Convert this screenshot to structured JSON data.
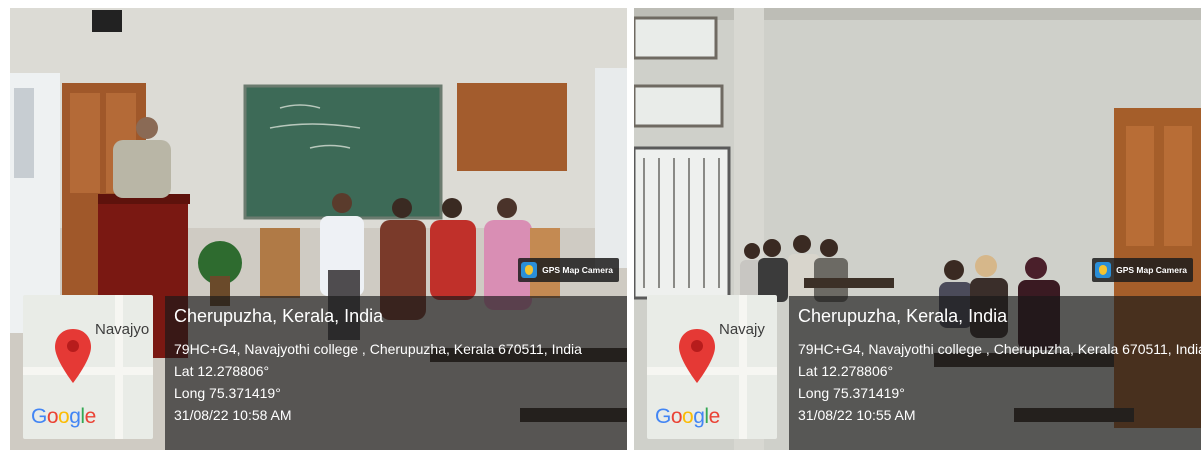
{
  "photos": [
    {
      "camera_badge": "GPS Map Camera",
      "map_pin_label": "Navajyo",
      "map_brand": "Google",
      "location_title": "Cherupuzha, Kerala, India",
      "address": "79HC+G4, Navajyothi college , Cherupuzha, Kerala 670511, India",
      "lat": "Lat 12.278806°",
      "long": "Long 75.371419°",
      "datetime": "31/08/22 10:58 AM"
    },
    {
      "camera_badge": "GPS Map Camera",
      "map_pin_label": "Navajy",
      "map_brand": "Google",
      "location_title": "Cherupuzha, Kerala, India",
      "address": "79HC+G4, Navajyothi college , Cherupuzha, Kerala 670511, India",
      "lat": "Lat 12.278806°",
      "long": "Long 75.371419°",
      "datetime": "31/08/22 10:55 AM"
    }
  ],
  "colors": {
    "google": [
      "#4285F4",
      "#EA4335",
      "#FBBC05",
      "#4285F4",
      "#34A853",
      "#EA4335"
    ],
    "pin": "#e53935",
    "caption_bg": "rgba(24,24,24,0.66)"
  }
}
